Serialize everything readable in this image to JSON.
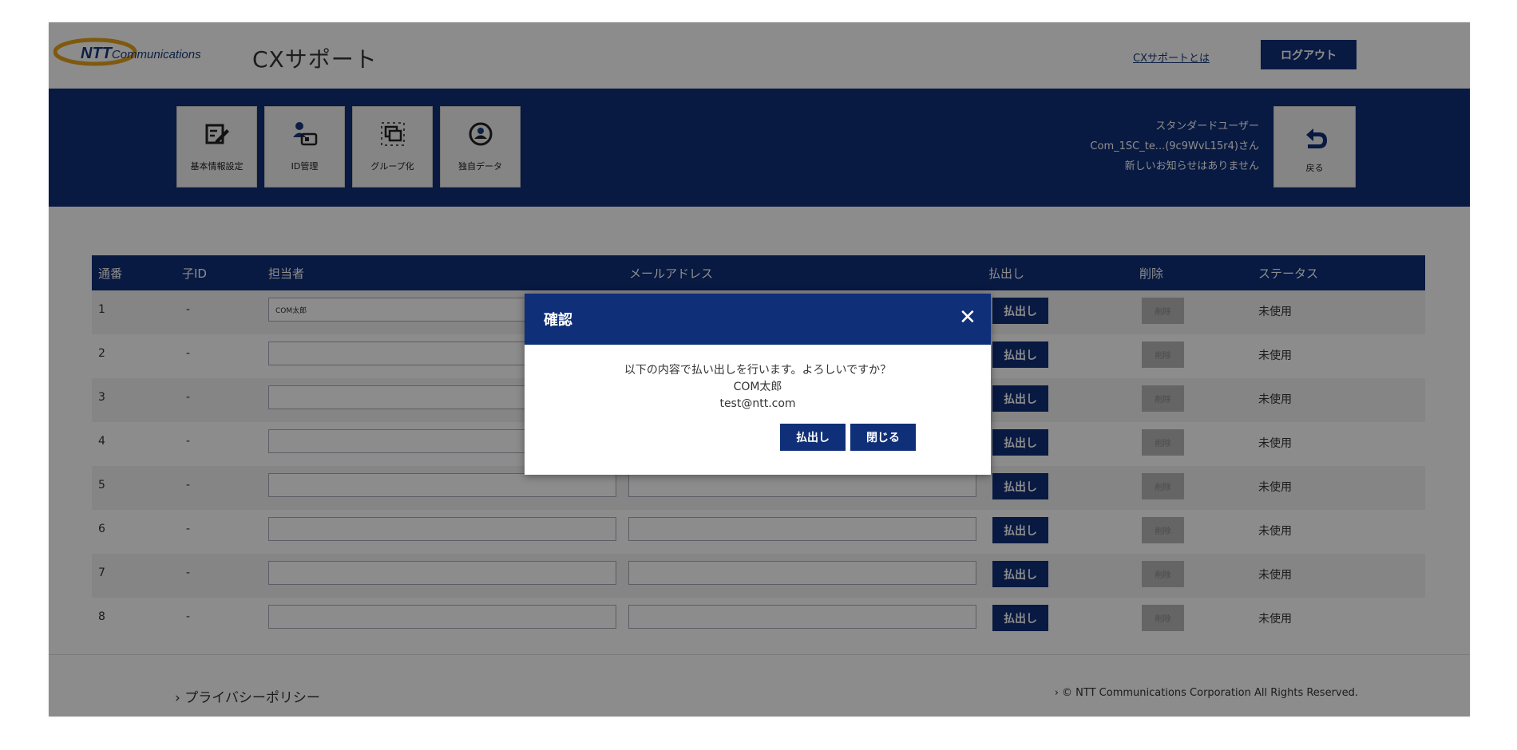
{
  "header": {
    "logo_bold": "NTT",
    "logo_rest": "Communications",
    "app_title": "CXサポート",
    "about_link": "CXサポートとは",
    "logout_label": "ログアウト"
  },
  "nav": {
    "tiles": [
      {
        "label": "基本情報設定",
        "icon": "edit-icon"
      },
      {
        "label": "ID管理",
        "icon": "user-id-icon"
      },
      {
        "label": "グループ化",
        "icon": "group-icon"
      },
      {
        "label": "独自データ",
        "icon": "custom-data-icon"
      }
    ],
    "user_role": "スタンダードユーザー",
    "user_name": "Com_1SC_te...(9c9WvL15r4)さん",
    "notice": "新しいお知らせはありません",
    "back_label": "戻る"
  },
  "table": {
    "headers": {
      "no": "通番",
      "child_id": "子ID",
      "person": "担当者",
      "email": "メールアドレス",
      "issue": "払出し",
      "delete": "削除",
      "status": "ステータス"
    },
    "rows": [
      {
        "no": "1",
        "child_id": "-",
        "person": "COM太郎",
        "email": "",
        "issue": "払出し",
        "delete": "削除",
        "status": "未使用"
      },
      {
        "no": "2",
        "child_id": "-",
        "person": "",
        "email": "",
        "issue": "払出し",
        "delete": "削除",
        "status": "未使用"
      },
      {
        "no": "3",
        "child_id": "-",
        "person": "",
        "email": "",
        "issue": "払出し",
        "delete": "削除",
        "status": "未使用"
      },
      {
        "no": "4",
        "child_id": "-",
        "person": "",
        "email": "",
        "issue": "払出し",
        "delete": "削除",
        "status": "未使用"
      },
      {
        "no": "5",
        "child_id": "-",
        "person": "",
        "email": "",
        "issue": "払出し",
        "delete": "削除",
        "status": "未使用"
      },
      {
        "no": "6",
        "child_id": "-",
        "person": "",
        "email": "",
        "issue": "払出し",
        "delete": "削除",
        "status": "未使用"
      },
      {
        "no": "7",
        "child_id": "-",
        "person": "",
        "email": "",
        "issue": "払出し",
        "delete": "削除",
        "status": "未使用"
      },
      {
        "no": "8",
        "child_id": "-",
        "person": "",
        "email": "",
        "issue": "払出し",
        "delete": "削除",
        "status": "未使用"
      }
    ]
  },
  "footer": {
    "privacy": "› プライバシーポリシー",
    "copyright": "› © NTT Communications Corporation All Rights Reserved."
  },
  "modal": {
    "title": "確認",
    "close_glyph": "✕",
    "message": "以下の内容で払い出しを行います。よろしいですか？",
    "person": "COM太郎",
    "email": "test@ntt.com",
    "confirm_label": "払出し",
    "close_label": "閉じる"
  },
  "colors": {
    "brand_navy": "#0f2f78",
    "overlay": "rgba(0,0,0,0.45)"
  }
}
